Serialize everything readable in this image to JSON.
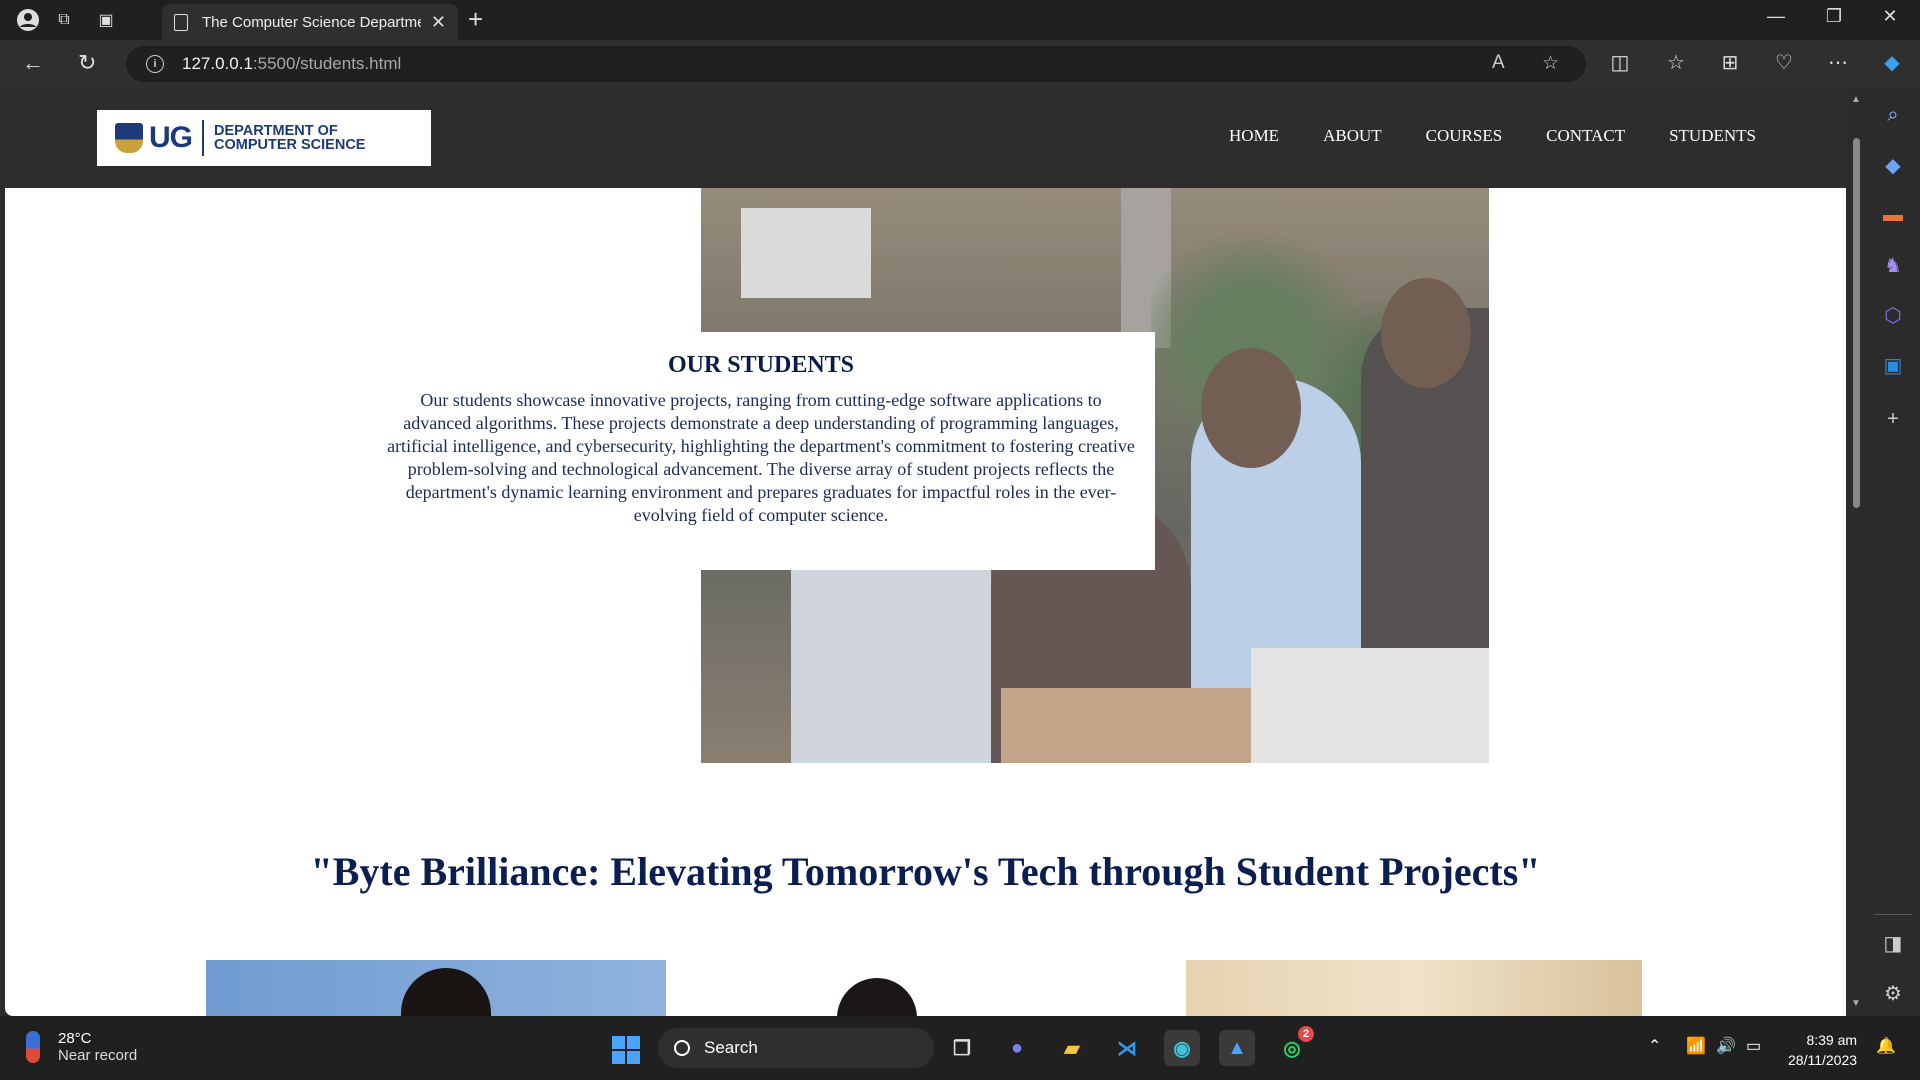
{
  "browser": {
    "tab_title": "The Computer Science Departme",
    "url_host": "127.0.0.1",
    "url_path": ":5500/students.html"
  },
  "site": {
    "logo_ug": "UG",
    "logo_line1": "DEPARTMENT OF",
    "logo_line2": "COMPUTER SCIENCE",
    "nav": [
      "HOME",
      "ABOUT",
      "COURSES",
      "CONTACT",
      "STUDENTS"
    ]
  },
  "intro": {
    "heading": "OUR STUDENTS",
    "body": "Our students showcase innovative projects, ranging from cutting-edge software applications to advanced algorithms. These projects demonstrate a deep understanding of programming languages, artificial intelligence, and cybersecurity, highlighting the department's commitment to fostering creative problem-solving and technological advancement. The diverse array of student projects reflects the department's dynamic learning environment and prepares graduates for impactful roles in the ever-evolving field of computer science."
  },
  "tagline": "\"Byte Brilliance: Elevating Tomorrow's Tech through Student Projects\"",
  "taskbar": {
    "weather_temp": "28°C",
    "weather_desc": "Near record",
    "search_label": "Search",
    "whatsapp_badge": "2",
    "time": "8:39 am",
    "date": "28/11/2023"
  },
  "colors": {
    "heading_navy": "#0b1e52",
    "header_bg": "#2d2d2d",
    "brand_blue": "#1b3a78"
  }
}
